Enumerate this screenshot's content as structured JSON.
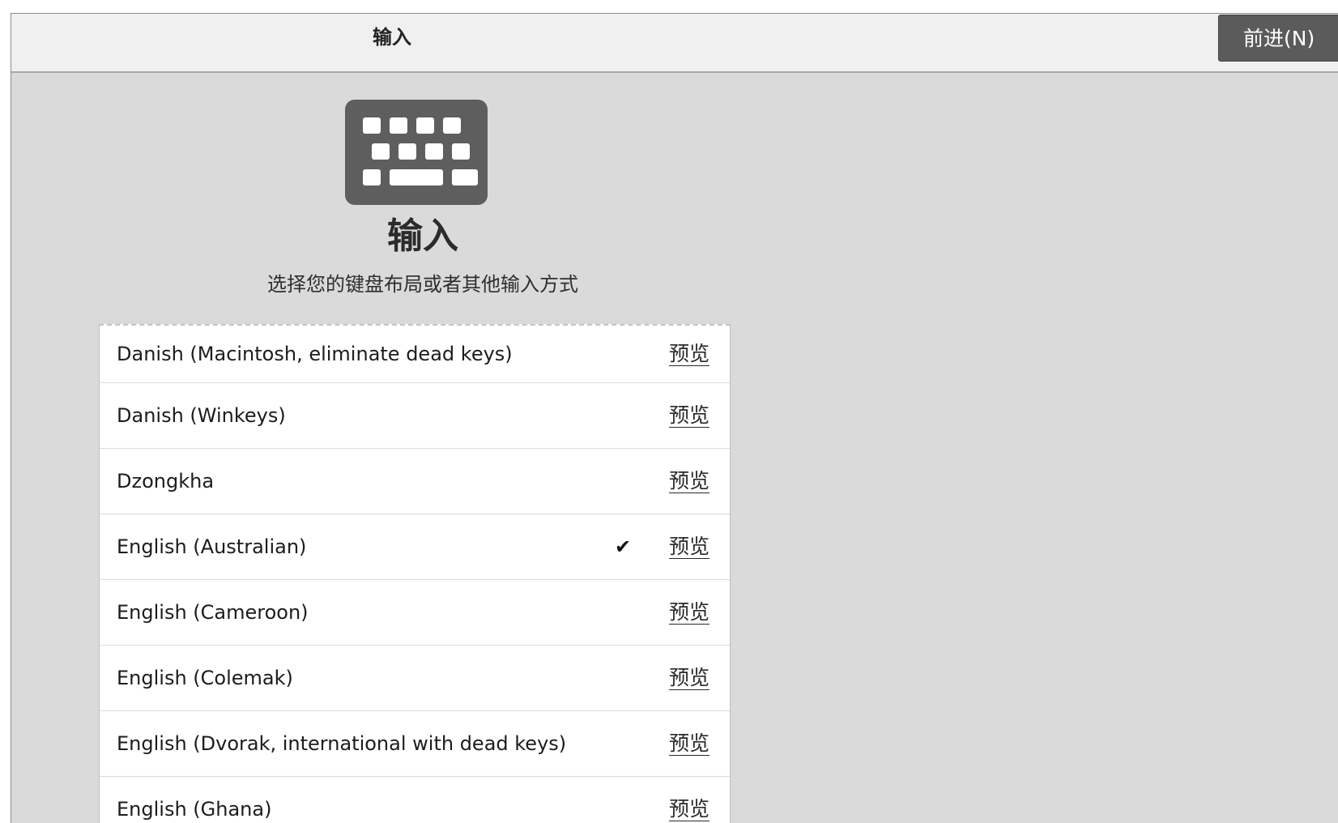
{
  "header": {
    "title": "输入",
    "next_button_label": "前进(N)"
  },
  "main": {
    "icon": "keyboard-icon",
    "title": "输入",
    "subtitle": "选择您的键盘布局或者其他输入方式"
  },
  "layouts": [
    {
      "name": "Danish (Macintosh, eliminate dead keys)",
      "selected": false,
      "preview_label": "预览"
    },
    {
      "name": "Danish (Winkeys)",
      "selected": false,
      "preview_label": "预览"
    },
    {
      "name": "Dzongkha",
      "selected": false,
      "preview_label": "预览"
    },
    {
      "name": "English (Australian)",
      "selected": true,
      "check": "✔",
      "preview_label": "预览"
    },
    {
      "name": "English (Cameroon)",
      "selected": false,
      "preview_label": "预览"
    },
    {
      "name": "English (Colemak)",
      "selected": false,
      "preview_label": "预览"
    },
    {
      "name": "English (Dvorak, international with dead keys)",
      "selected": false,
      "preview_label": "预览"
    },
    {
      "name": "English (Ghana)",
      "selected": false,
      "preview_label": "预览"
    }
  ],
  "colors": {
    "header_bg": "#f0f0f0",
    "body_bg": "#dadada",
    "button_bg": "#5b5b5b",
    "icon_color": "#5e5e5e"
  }
}
